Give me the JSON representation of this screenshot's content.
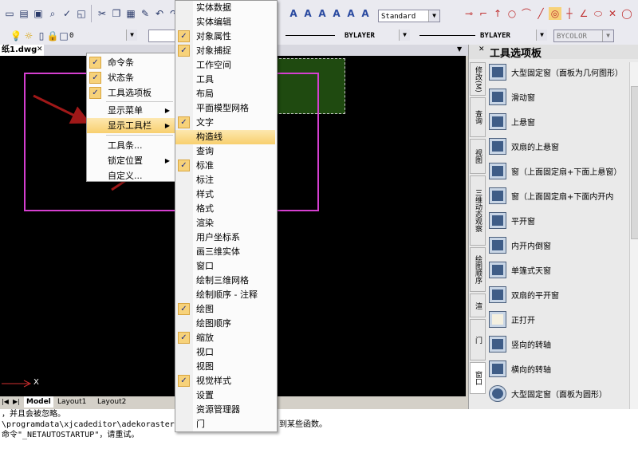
{
  "doc_tab": "纸1.dwg",
  "toolbar": {
    "textstyle": "Standard",
    "layer": "0",
    "linetype1": "BYLAYER",
    "linetype2": "BYLAYER",
    "color": "BYCOLOR",
    "glyph_text": "A"
  },
  "layout_tabs": [
    "Model",
    "Layout1",
    "Layout2"
  ],
  "axis_x": "X",
  "command_lines": [
    "，并且会被忽略。",
    "\\programdata\\xjcadeditor\\adekorastersc",
    "命令\"_NETAUTOSTARTUP\"，请重试。"
  ],
  "command_tail": "到某些函数。",
  "context_menu": [
    {
      "label": "命令条",
      "checked": true
    },
    {
      "label": "状态条",
      "checked": true
    },
    {
      "label": "工具选项板",
      "checked": true
    },
    {
      "label": "显示菜单",
      "submenu": true
    },
    {
      "label": "显示工具栏",
      "submenu": true,
      "highlight": true
    },
    {
      "label": "工具条..."
    },
    {
      "label": "锁定位置",
      "submenu": true
    },
    {
      "label": "自定义..."
    }
  ],
  "submenu": [
    {
      "label": "实体数据",
      "checked": false
    },
    {
      "label": "实体编辑",
      "checked": false
    },
    {
      "label": "对象属性",
      "checked": true
    },
    {
      "label": "对象捕捉",
      "checked": true
    },
    {
      "label": "工作空间",
      "checked": false
    },
    {
      "label": "工具",
      "checked": false
    },
    {
      "label": "布局",
      "checked": false
    },
    {
      "label": "平面模型网格",
      "checked": false
    },
    {
      "label": "文字",
      "checked": true
    },
    {
      "label": "构造线",
      "checked": false,
      "highlight": true
    },
    {
      "label": "查询",
      "checked": false
    },
    {
      "label": "标准",
      "checked": true
    },
    {
      "label": "标注",
      "checked": false
    },
    {
      "label": "样式",
      "checked": false
    },
    {
      "label": "格式",
      "checked": false
    },
    {
      "label": "渲染",
      "checked": false
    },
    {
      "label": "用户坐标系",
      "checked": false
    },
    {
      "label": "画三维实体",
      "checked": false
    },
    {
      "label": "窗口",
      "checked": false
    },
    {
      "label": "绘制三维网格",
      "checked": false
    },
    {
      "label": "绘制顺序 - 注释",
      "checked": false
    },
    {
      "label": "绘图",
      "checked": true
    },
    {
      "label": "绘图顺序",
      "checked": false
    },
    {
      "label": "缩放",
      "checked": true
    },
    {
      "label": "视口",
      "checked": false
    },
    {
      "label": "视图",
      "checked": false
    },
    {
      "label": "视觉样式",
      "checked": true
    },
    {
      "label": "设置",
      "checked": false
    },
    {
      "label": "资源管理器",
      "checked": false
    },
    {
      "label": "门",
      "checked": false
    }
  ],
  "palette": {
    "title": "工具选项板",
    "tabs": [
      "修改(M)",
      "查询",
      "视图",
      "三维动态观察",
      "绘图顺序",
      "渲",
      "门",
      "窗口"
    ],
    "items": [
      "大型固定窗（面板为几何图形）",
      "滑动窗",
      "上悬窗",
      "双扇的上悬窗",
      "窗（上面固定扇+下面上悬窗）",
      "窗（上面固定扇+下面内开内",
      "平开窗",
      "内开内倒窗",
      "单篷式天窗",
      "双扇的平开窗",
      "正打开",
      "竖向的转轴",
      "横向的转轴",
      "大型固定窗（面板为圆形）"
    ]
  }
}
